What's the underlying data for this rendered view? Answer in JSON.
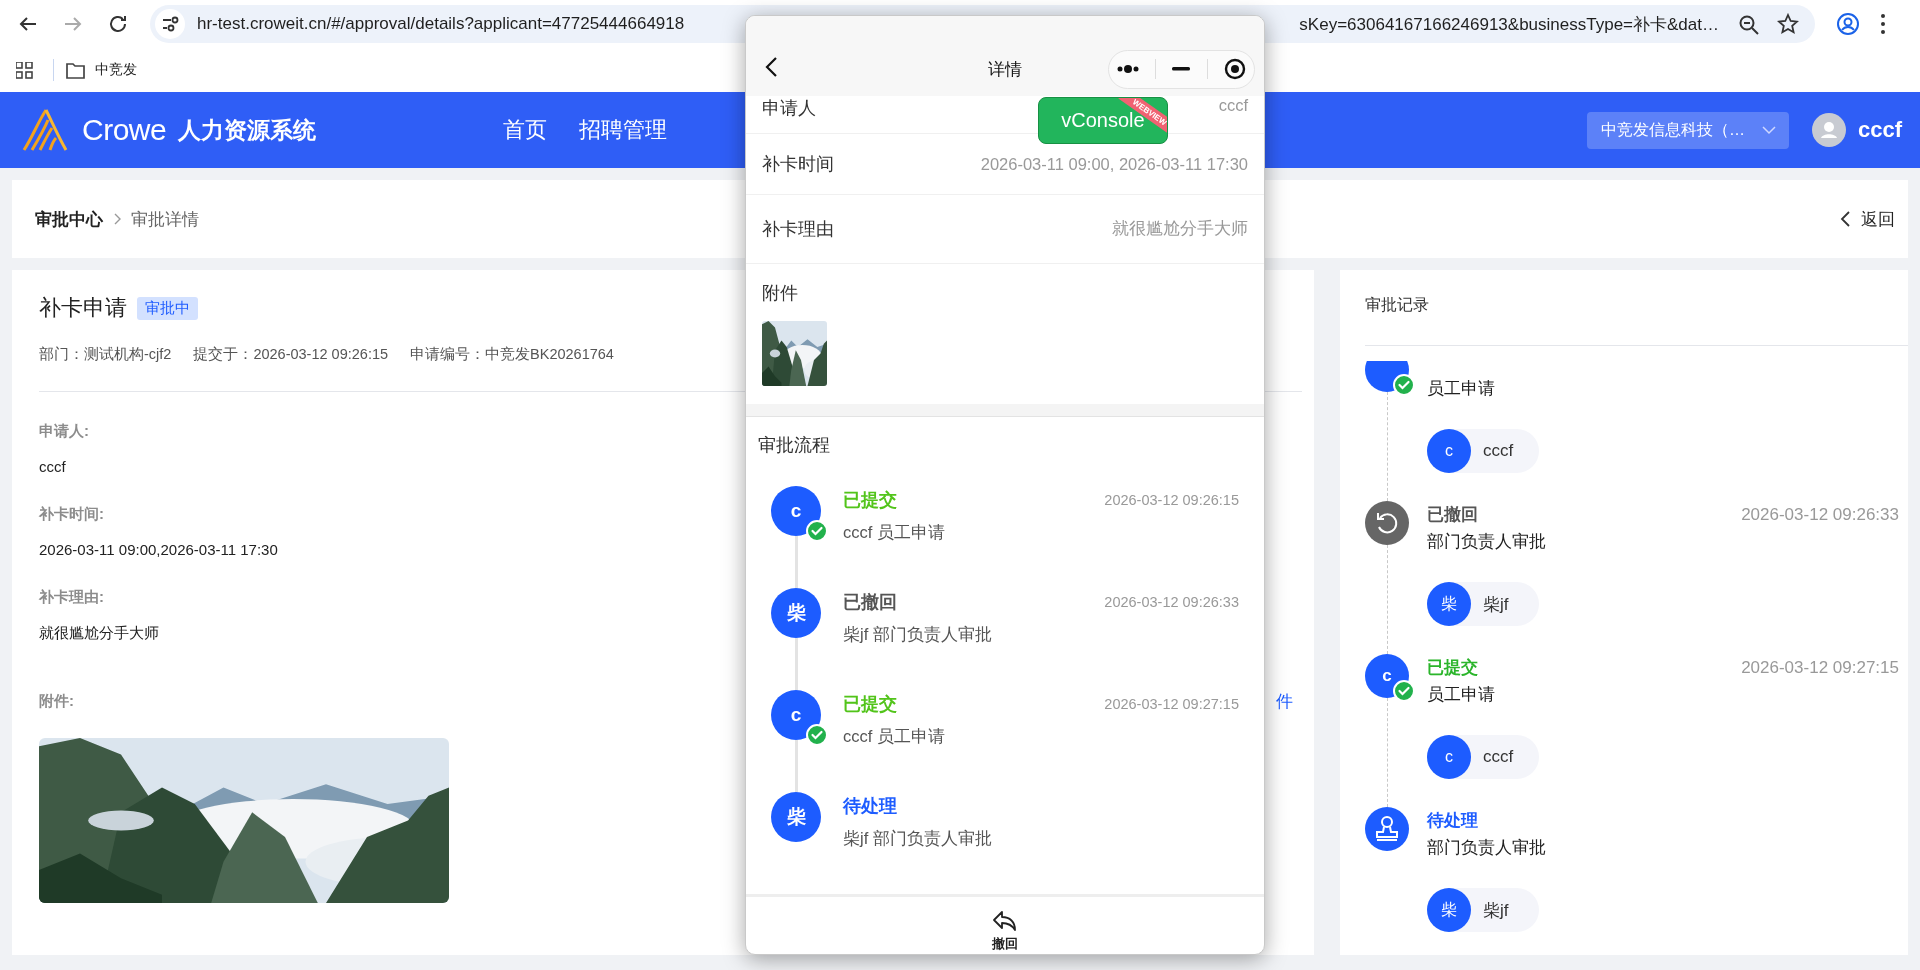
{
  "browser": {
    "url_start": "hr-test.croweit.cn/#/approval/details?applicant=47725444664918",
    "url_end": "sKey=63064167166246913&businessType=补卡&dat…",
    "bookmarks": [
      {
        "label": "中竞发"
      }
    ]
  },
  "header": {
    "brand": "Crowe",
    "system": "人力资源系统",
    "nav": [
      {
        "label": "首页"
      },
      {
        "label": "招聘管理"
      }
    ],
    "company": "中竞发信息科技（…",
    "user": "cccf"
  },
  "breadcrumb": {
    "items": [
      {
        "label": "审批中心"
      },
      {
        "label": "审批详情"
      }
    ],
    "back": "返回"
  },
  "application": {
    "title": "补卡申请",
    "status": "审批中",
    "meta": [
      "部门：测试机构-cjf2",
      "提交于：2026-03-12 09:26:15",
      "申请编号：中竞发BK20261764"
    ],
    "fields": [
      {
        "label": "申请人:",
        "value": "cccf"
      },
      {
        "label": "补卡时间:",
        "value": "2026-03-11 09:00,2026-03-11 17:30"
      },
      {
        "label": "补卡理由:",
        "value": "就很尴尬分手大师"
      }
    ],
    "attachment_label": "附件:",
    "attachment_link": "件",
    "attachment": {
      "kind": "picture"
    }
  },
  "record": {
    "title": "审批记录",
    "items": [
      {
        "kind": "submitted",
        "node": "员工申请",
        "person": {
          "initial": "c",
          "name": "cccf"
        }
      },
      {
        "kind": "withdrawn",
        "status": "已撤回",
        "time": "2026-03-12 09:26:33",
        "node": "部门负责人审批",
        "person": {
          "initial": "柴",
          "name": "柴jf"
        }
      },
      {
        "kind": "submitted",
        "status": "已提交",
        "time": "2026-03-12 09:27:15",
        "avatar": "c",
        "node": "员工申请",
        "person": {
          "initial": "c",
          "name": "cccf"
        }
      },
      {
        "kind": "pending",
        "status": "待处理",
        "node": "部门负责人审批",
        "person": {
          "initial": "柴",
          "name": "柴jf"
        }
      }
    ]
  },
  "mini_program": {
    "title": "详情",
    "fields": [
      {
        "label": "申请人",
        "value": "cccf"
      },
      {
        "label": "补卡时间",
        "value": "2026-03-11 09:00, 2026-03-11 17:30"
      },
      {
        "label": "补卡理由",
        "value": "就很尴尬分手大师"
      }
    ],
    "attachment_label": "附件",
    "attachment": {
      "kind": "picture"
    },
    "flow_title": "审批流程",
    "steps": [
      {
        "kind": "submitted",
        "status": "已提交",
        "time": "2026-03-12 09:26:15",
        "initial": "c",
        "desc": "cccf 员工申请"
      },
      {
        "kind": "withdrawn",
        "status": "已撤回",
        "time": "2026-03-12 09:26:33",
        "initial": "柴",
        "desc": "柴jf 部门负责人审批"
      },
      {
        "kind": "submitted",
        "status": "已提交",
        "time": "2026-03-12 09:27:15",
        "initial": "c",
        "desc": "cccf 员工申请"
      },
      {
        "kind": "pending",
        "status": "待处理",
        "initial": "柴",
        "desc": "柴jf 部门负责人审批"
      }
    ],
    "action": "撤回"
  },
  "vconsole": {
    "label": "vConsole",
    "ribbon": "WEBVIEW"
  }
}
